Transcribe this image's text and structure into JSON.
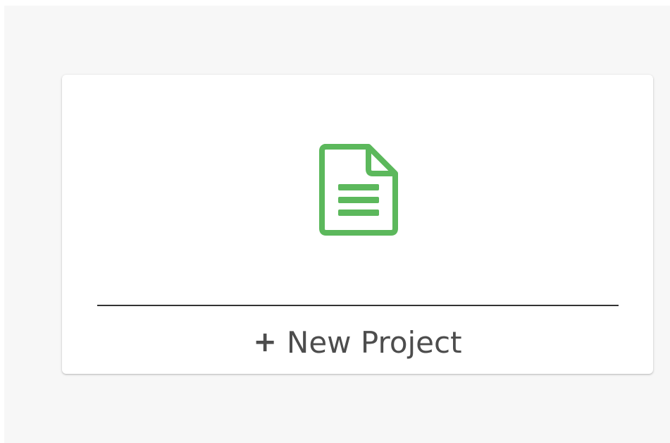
{
  "card": {
    "icon": "document-icon",
    "plus_symbol": "+",
    "label": "New Project"
  },
  "colors": {
    "icon_green": "#5cb85c",
    "text": "#4d4d4d",
    "divider": "#333333",
    "background": "#f7f7f7",
    "card": "#ffffff"
  }
}
